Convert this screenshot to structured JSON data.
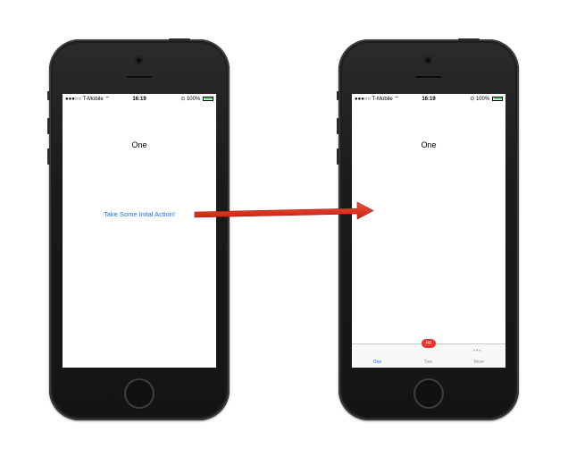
{
  "left_phone": {
    "status": {
      "carrier": "●●●○○ T-Mobile",
      "time": "16:19",
      "battery": "100%"
    },
    "title": "One",
    "action_label": "Take Some Inital Action!"
  },
  "right_phone": {
    "status": {
      "carrier": "●●●○○ T-Mobile",
      "time": "16:19",
      "battery": "100%"
    },
    "title": "One",
    "tabs": [
      {
        "label": "One",
        "active": true
      },
      {
        "label": "Two",
        "badge": "Hi!"
      },
      {
        "label": "More",
        "icon": "more-dots-icon"
      }
    ]
  },
  "colors": {
    "link": "#1c74e0",
    "badge": "#e8372d",
    "arrow": "#e53222",
    "battery": "#4cd964"
  }
}
